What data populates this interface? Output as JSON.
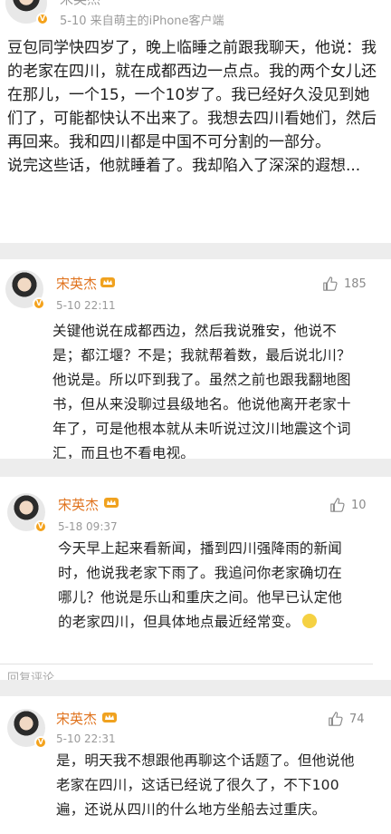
{
  "post": {
    "author": "宋英杰",
    "meta": "5-10  来自萌主的iPhone客户端",
    "text": "豆包同学快四岁了，晚上临睡之前跟我聊天，他说：我的老家在四川，就在成都西边一点点。我的两个女儿还在那儿，一个15，一个10岁了。我已经好久没见到她们了，可能都快认不出来了。我想去四川看她们，然后再回来。我和四川都是中国不可分割的一部分。\n说完这些话，他就睡着了。我却陷入了深深的遐想..."
  },
  "comments": [
    {
      "author": "宋英杰",
      "time": "5-10 22:11",
      "likes": "185",
      "text": "关键他说在成都西边，然后我说雅安，他说不是；都江堰？不是；我就帮着数，最后说北川？他说是。所以吓到我了。虽然之前也跟我翻地图书，但从来没聊过县级地名。他说他离开老家十年了，可是他根本就从未听说过汶川地震这个词汇，而且也不看电视。"
    },
    {
      "author": "宋英杰",
      "time": "5-18 09:37",
      "likes": "10",
      "text": "今天早上起来看新闻，播到四川强降雨的新闻时，他说我老家下雨了。我追问你老家确切在哪儿？他说是乐山和重庆之间。他早已认定他的老家四川，但具体地点最近经常变。",
      "reply_hint": "回复评论"
    },
    {
      "author": "宋英杰",
      "time": "5-10 22:31",
      "likes": "74",
      "text": "是，明天我不想跟他再聊这个话题了。但他说他老家在四川，这话已经说了很久了，不下100遍，还说从四川的什么地方坐船去过重庆。"
    }
  ],
  "colors": {
    "username": "#e0731e",
    "meta": "#9a9a9a",
    "divider": "#ededed"
  }
}
